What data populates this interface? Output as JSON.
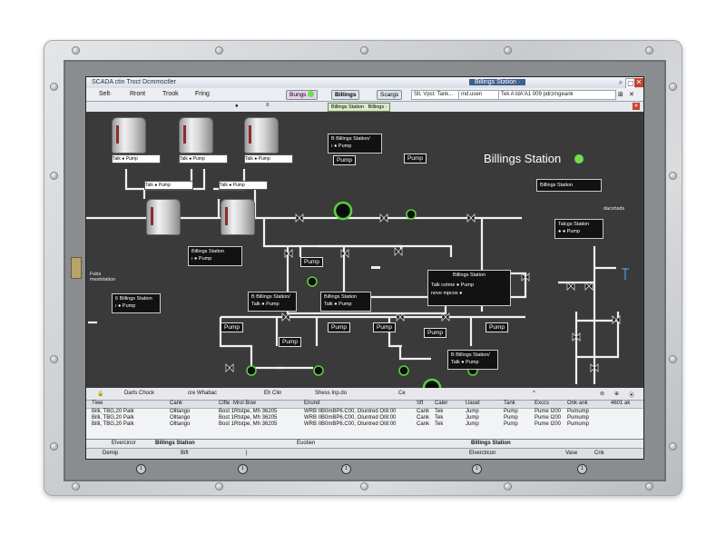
{
  "window": {
    "title_left": "SCADA ctin   Troct Dcmmsctler",
    "title_mid": "Billings Station ·",
    "controls": [
      "⌕",
      "▢",
      "✕"
    ]
  },
  "menubar": {
    "items": [
      "Selt·",
      "Rront",
      "Trook",
      "Fring"
    ],
    "buttons": [
      "Bungs",
      "Billings",
      "Scargs"
    ],
    "fields": [
      "Slt, Vpst: Tank...",
      "md.usen",
      "Tek  A ldA'A1 009  pdrzmgeank"
    ],
    "right_icons": [
      "⊞",
      "✕"
    ]
  },
  "breadcrumb": {
    "station": "Billings Station",
    "menu": "Billings ·"
  },
  "hmi": {
    "station_title": "Billings Station",
    "station_status_color": "#6ede52",
    "tank_label": "Talk  ●  Pump",
    "panels": [
      {
        "id": "p1",
        "title": "B  Billings Station/",
        "line": "ı  ●  Pump"
      },
      {
        "id": "p2",
        "title": "Billings Station",
        "line": "●  ●  ●"
      },
      {
        "id": "p3",
        "title": "Billings Station",
        "line": "ı  ●  Pump"
      },
      {
        "id": "p4",
        "title": "B  Billings Station/",
        "line": "Talk  ●  Pump"
      },
      {
        "id": "p5",
        "title": "Billings Station",
        "line": "Talk  ●  Pump"
      },
      {
        "id": "p6",
        "title": "6  Billings Station",
        "line": "ı  ●  Pump"
      },
      {
        "id": "p7",
        "title": "Billings Station",
        "line": "Talk cotme  ●  Pump",
        "line2": "nove mpcos  ●"
      },
      {
        "id": "p8",
        "title": "Talcgs Station",
        "line": "●  ●  Pump"
      },
      {
        "id": "p9",
        "title": "B  Billings Station/",
        "line": "Talk  ●  Pump"
      }
    ],
    "pump_label": "Pump",
    "notes": {
      "left": "Fubs\nmeststation",
      "right": "dacshsds"
    }
  },
  "alarm": {
    "toolbar": [
      "Darts Chock",
      "cre Whabac",
      "Eh Clin",
      "Shess Inp.do",
      "Ce"
    ],
    "toolbar_right": [
      "^",
      "⊜",
      "⊕",
      "⦿"
    ],
    "columns": [
      "Tiwe",
      "Cank",
      "Clfte  ·Mrol Bow",
      "Enuret",
      "Sft",
      "Caler",
      "Uaset",
      "Tank",
      "Exccs",
      "Onk·ank",
      "4601 ak"
    ],
    "rows": [
      [
        "Billi, TBG,20 Palk",
        "Olltango",
        "Bost 1Rtstpe, Mh 36205",
        "WRB  IIB0mBP6.C00, Oluntred OI8:00",
        "Cank",
        "Tek",
        "Jump",
        "Pump",
        "Pume I200",
        "Pumump"
      ],
      [
        "Billi, TBG,20 Palk",
        "Olltango",
        "Bost 1Rtstpe, Mh 36205",
        "WRB  IIB0mBP6.C00, Oluntred OI8:00",
        "Cank",
        "Tek",
        "Jump",
        "Pump",
        "Pume I200",
        "Pumump"
      ],
      [
        "Billi, TBG,20 Palk",
        "Olltango",
        "Bost 1Rtstpe, Mh 36205",
        "WRB  IIB0mBP6.C00, Oluntred OI8:00",
        "Cank",
        "Tek",
        "Jump",
        "Pump",
        "Pume I200",
        "Pumump"
      ]
    ],
    "footer1": {
      "left": "Elvercinor",
      "station": "Billings Station",
      "mid": "Euotien",
      "right": "Billings Station"
    },
    "footer2": {
      "a": "Demip",
      "b": "Bift",
      "c": "Elvercticon",
      "d": "Vase",
      "e": "Cnk"
    }
  }
}
